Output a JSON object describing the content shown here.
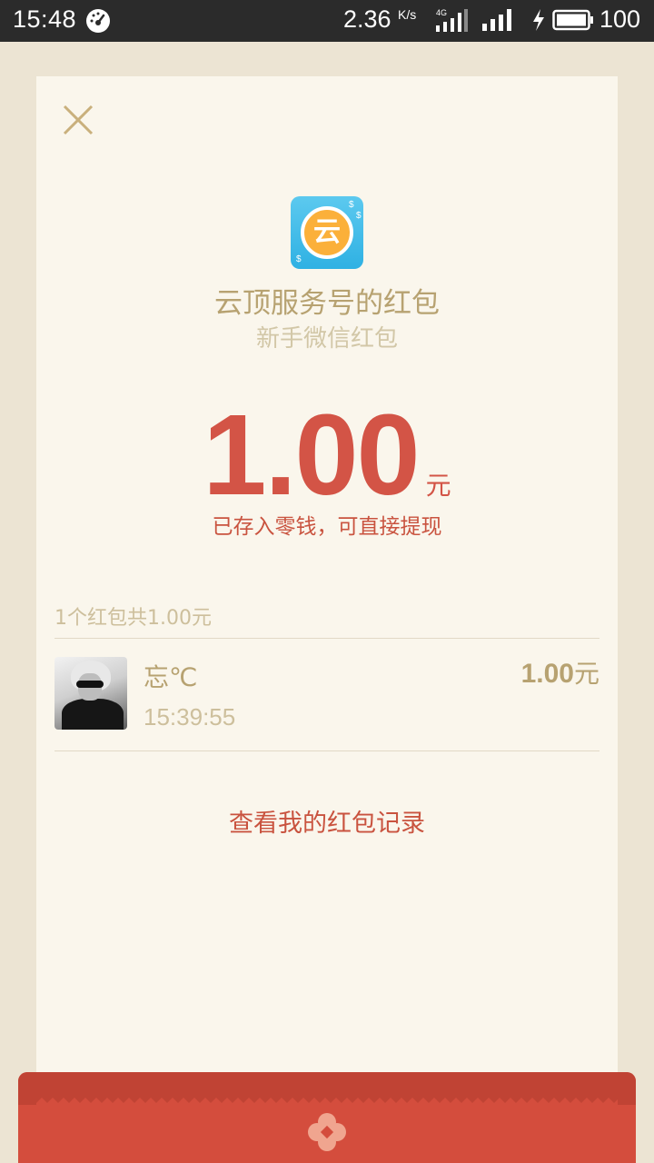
{
  "status_bar": {
    "time": "15:48",
    "network_speed": "2.36",
    "speed_unit": "K/s",
    "network_type": "4G",
    "battery_level": "100",
    "icons": [
      "speedometer-icon",
      "signal-4g-icon",
      "signal-icon",
      "charging-icon",
      "battery-icon"
    ]
  },
  "red_packet": {
    "sender_title": "云顶服务号的红包",
    "sender_subtitle": "新手微信红包",
    "app_icon_glyph": "云",
    "amount": "1.00",
    "amount_unit": "元",
    "deposit_note": "已存入零钱，可直接提现",
    "summary": "1个红包共1.00元"
  },
  "records": [
    {
      "name": "忘℃",
      "time": "15:39:55",
      "amount": "1.00",
      "unit": "元"
    }
  ],
  "history_link": "查看我的红包记录",
  "colors": {
    "background": "#ece4d3",
    "card": "#faf6ec",
    "accent_red": "#d35446",
    "gold_text": "#b7a271",
    "band_red": "#d44d3d"
  }
}
